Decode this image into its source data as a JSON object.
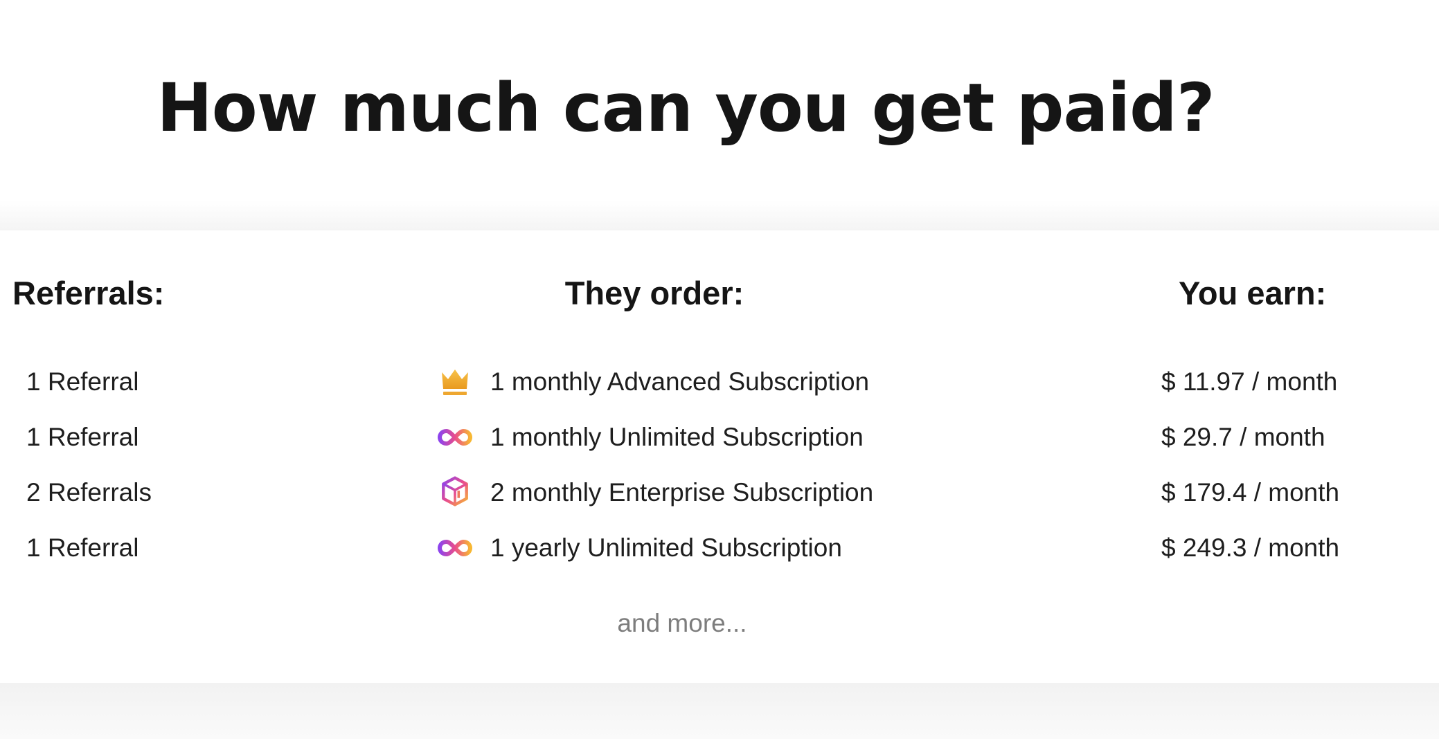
{
  "hero": {
    "title": "How much can you get paid?"
  },
  "table": {
    "headers": {
      "referrals": "Referrals:",
      "order": "They order:",
      "earn": "You earn:"
    },
    "rows": [
      {
        "referrals": "1 Referral",
        "icon": "crown-icon",
        "order": "1 monthly Advanced Subscription",
        "earn": "$ 11.97 / month"
      },
      {
        "referrals": "1 Referral",
        "icon": "infinity-icon",
        "order": "1 monthly Unlimited Subscription",
        "earn": "$ 29.7 / month"
      },
      {
        "referrals": "2 Referrals",
        "icon": "enterprise-box-icon",
        "order": "2 monthly Enterprise Subscription",
        "earn": "$ 179.4 / month"
      },
      {
        "referrals": "1 Referral",
        "icon": "infinity-icon",
        "order": "1 yearly Unlimited Subscription",
        "earn": "$ 249.3 / month"
      }
    ],
    "more": "and more..."
  },
  "colors": {
    "heading": "#151515",
    "text": "#1e1e1e",
    "muted": "#7d7d7d",
    "gradient_gold": "#f7b733",
    "gradient_purple": "#8e44ec",
    "gradient_pink": "#e94d8c"
  }
}
